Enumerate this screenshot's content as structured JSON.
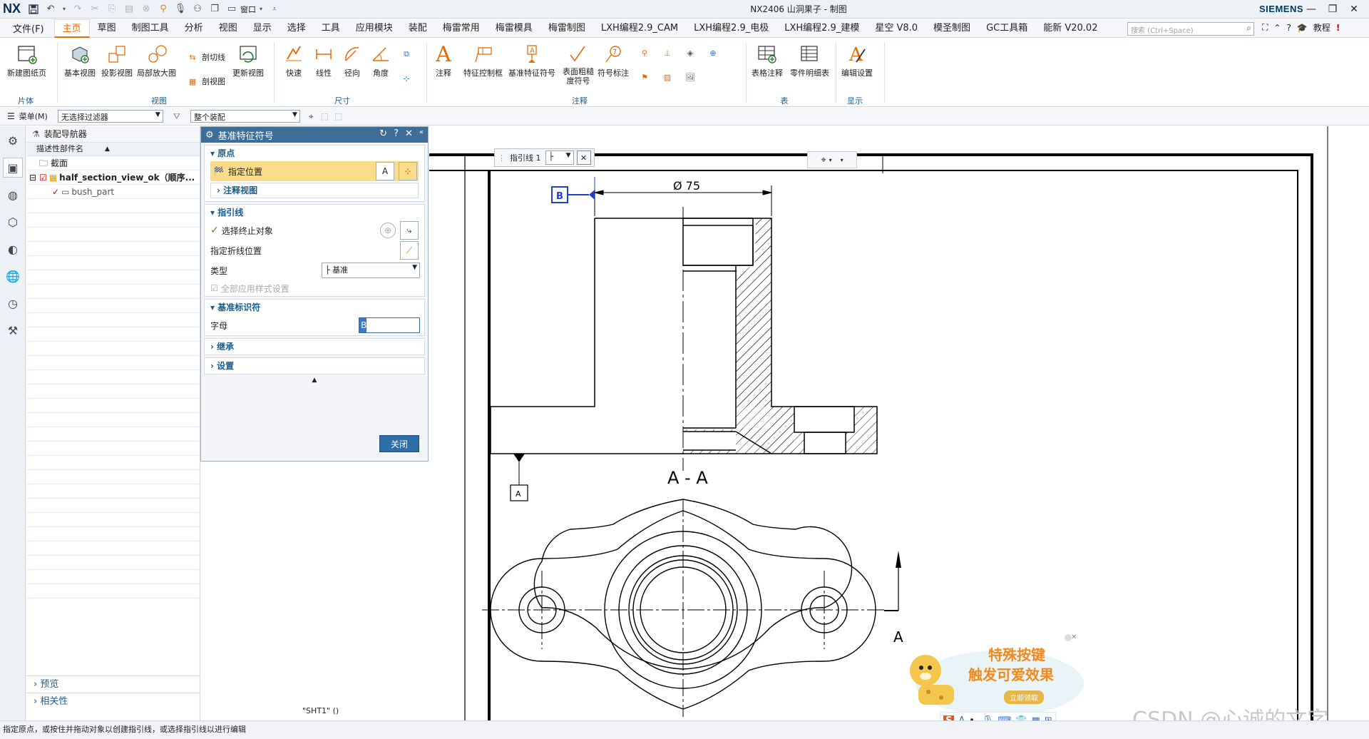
{
  "titlebar": {
    "logo": "NX",
    "title": "NX2406 山洞果子 - 制图",
    "brand": "SIEMENS",
    "window_label": "窗口"
  },
  "menubar": {
    "file": "文件(F)",
    "tabs": [
      "主页",
      "草图",
      "制图工具",
      "分析",
      "视图",
      "显示",
      "选择",
      "工具",
      "应用模块",
      "装配",
      "梅雷常用",
      "梅雷模具",
      "梅雷制图",
      "LXH编程2.9_CAM",
      "LXH编程2.9_电极",
      "LXH编程2.9_建模",
      "星空 V8.0",
      "模圣制图",
      "GC工具箱",
      "能新 V20.02"
    ],
    "active_tab": "主页",
    "search_placeholder": "搜索 (Ctrl+Space)",
    "tutorial": "教程"
  },
  "ribbon": {
    "new_sheet": "新建图纸页",
    "base_view": "基本视图",
    "projected_view": "投影视图",
    "detail_view": "局部放大图",
    "section_line": "剖切线",
    "section_view": "剖视图",
    "update_view": "更新视图",
    "quick": "快速",
    "linear": "线性",
    "radial": "径向",
    "angular": "角度",
    "note": "注释",
    "fcf": "特征控制框",
    "datum_symbol": "基准特征符号",
    "surface_finish": "表面粗糙度符号",
    "symbol_note": "符号标注",
    "table_note": "表格注释",
    "parts_list": "零件明细表",
    "edit_settings": "编辑设置",
    "groups": {
      "sheet": "片体",
      "view": "视图",
      "dimension": "尺寸",
      "annotation": "注释",
      "table": "表",
      "display": "显示"
    }
  },
  "selbar": {
    "menu": "菜单(M)",
    "filter": "无选择过滤器",
    "scope": "整个装配"
  },
  "navigator": {
    "title": "装配导航器",
    "column": "描述性部件名",
    "rows": [
      {
        "name": "截面"
      },
      {
        "name": "half_section_view_ok（顺序..."
      },
      {
        "name": "bush_part"
      }
    ],
    "preview": "预览",
    "dependency": "相关性"
  },
  "dialog": {
    "title": "基准特征符号",
    "origin": "原点",
    "specify_location": "指定位置",
    "annotation_view": "注释视图",
    "leader": "指引线",
    "select_terminating": "选择终止对象",
    "specify_jog": "指定折线位置",
    "type_label": "类型",
    "type_value": "基准",
    "apply_all": "全部应用样式设置",
    "datum_identifier": "基准标识符",
    "letter_label": "字母",
    "letter_value": "B",
    "inherit": "继承",
    "settings": "设置",
    "close": "关闭"
  },
  "canvas": {
    "leader_toolbar": "指引线 1",
    "diameter_dim": "Ø 75",
    "section_label": "A - A",
    "datum_b": "B",
    "datum_a": "A",
    "section_arrow_label": "A",
    "sheet_name": "\"SHT1\" ()"
  },
  "status": "指定原点，或按住并拖动对象以创建指引线，或选择指引线以进行编辑",
  "sticker": {
    "line1": "特殊按键",
    "line2": "触发可爱效果",
    "button": "立即领取"
  },
  "watermark": "CSDN @心诚的文字",
  "colors": {
    "accent": "#e46c0a",
    "dialog_title": "#3e6e98",
    "highlight": "#fbdc8a",
    "datum_blue": "#1c3fd4"
  }
}
